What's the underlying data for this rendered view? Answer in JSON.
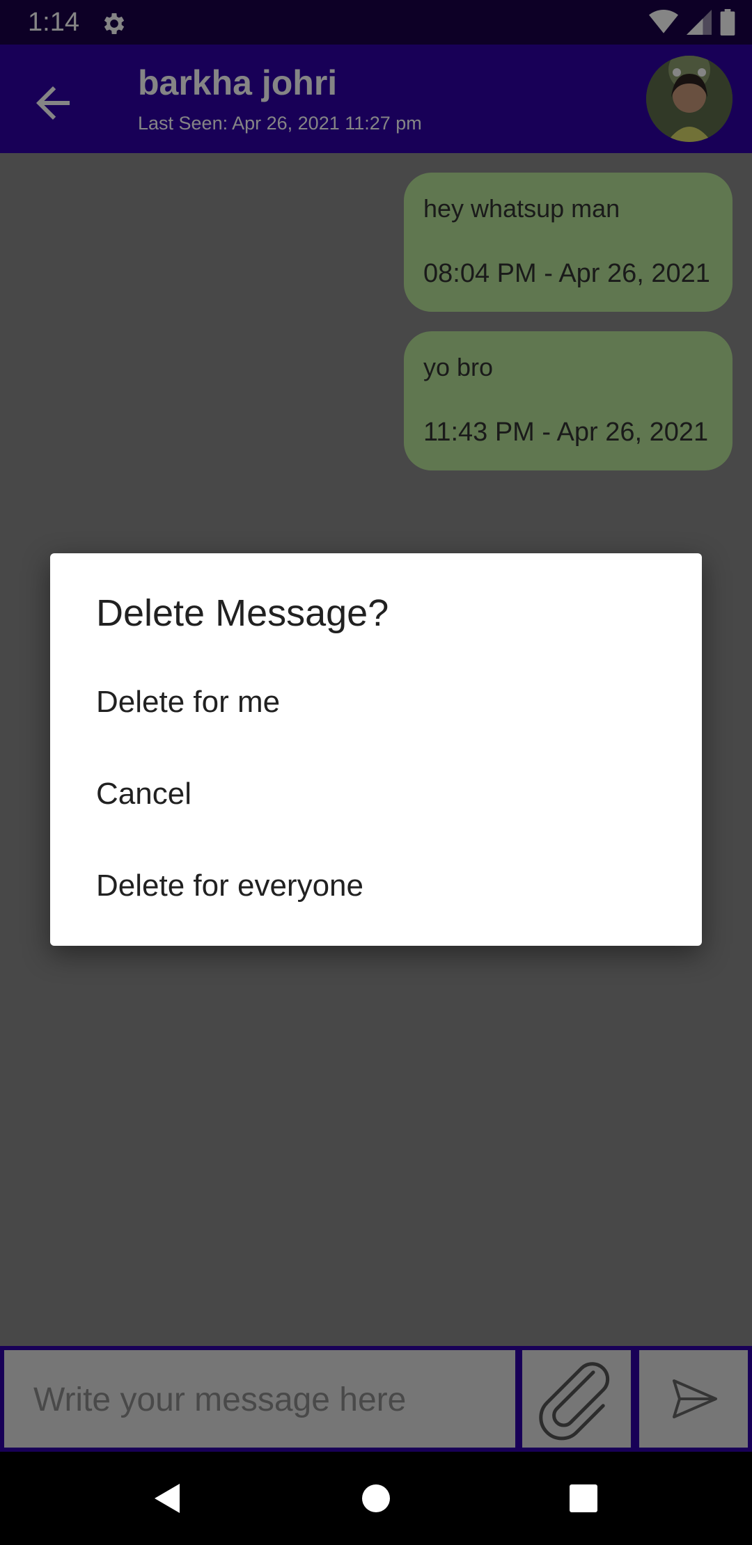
{
  "status_bar": {
    "time": "1:14",
    "icons": [
      "gear-icon",
      "wifi-icon",
      "signal-icon",
      "battery-icon"
    ]
  },
  "header": {
    "back_icon": "arrow-left-icon",
    "contact_name": "barkha johri",
    "last_seen": "Last Seen: Apr 26, 2021 11:27 pm"
  },
  "messages": [
    {
      "text": "hey whatsup man",
      "time": "08:04 PM - Apr 26, 2021"
    },
    {
      "text": "yo bro",
      "time": "11:43 PM - Apr 26, 2021"
    }
  ],
  "dialog": {
    "title": "Delete Message?",
    "options": [
      "Delete for me",
      "Cancel",
      "Delete for everyone"
    ]
  },
  "composer": {
    "placeholder": "Write your message here",
    "attach_icon": "paperclip-icon",
    "send_icon": "send-icon"
  },
  "colors": {
    "primary_dark": "#1a0049",
    "primary": "#2e00a8",
    "bubble": "#b9e59a",
    "input_background": "#e2e2e2"
  },
  "nav_bar": {
    "icons": [
      "back-triangle-icon",
      "home-circle-icon",
      "recents-square-icon"
    ]
  }
}
